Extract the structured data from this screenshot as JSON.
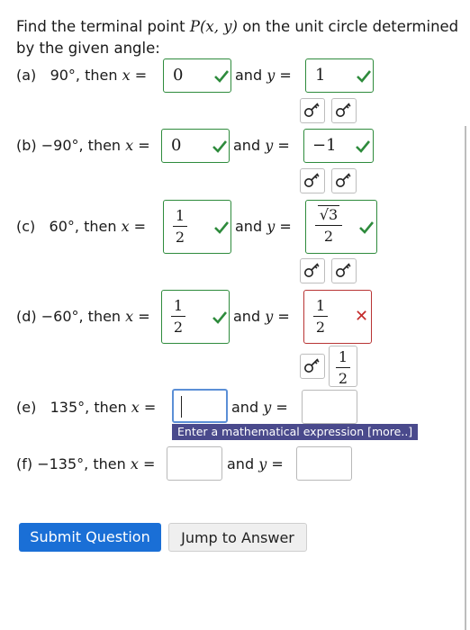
{
  "question": {
    "prompt_pre": "Find the terminal point ",
    "prompt_math": "P(x, y)",
    "prompt_post": " on the unit circle determined by the given angle:"
  },
  "parts": [
    {
      "label": "(a)",
      "angle": "90°",
      "x_value": "0",
      "y_value": "1",
      "x_status": "correct",
      "y_status": "correct"
    },
    {
      "label": "(b)",
      "angle": "−90°",
      "x_value": "0",
      "y_value": "−1",
      "x_status": "correct",
      "y_status": "correct"
    },
    {
      "label": "(c)",
      "angle": "60°",
      "x_num": "1",
      "x_den": "2",
      "y_num": "√3",
      "y_den": "2",
      "x_status": "correct",
      "y_status": "correct"
    },
    {
      "label": "(d)",
      "angle": "−60°",
      "x_num": "1",
      "x_den": "2",
      "y_num": "1",
      "y_den": "2",
      "x_status": "correct",
      "y_status": "incorrect",
      "y_answer_num": "1",
      "y_answer_den": "2"
    },
    {
      "label": "(e)",
      "angle": "135°",
      "x_value": "",
      "y_value": "",
      "x_status": "active",
      "y_status": "blank"
    },
    {
      "label": "(f)",
      "angle": "−135°",
      "x_value": "",
      "y_value": "",
      "x_status": "blank",
      "y_status": "blank"
    }
  ],
  "text": {
    "then_x": ", then ",
    "x_var": "x",
    "equals": " =",
    "and_y": "and ",
    "y_var": "y"
  },
  "tooltip": "Enter a mathematical expression [more..]",
  "buttons": {
    "submit": "Submit Question",
    "jump": "Jump to Answer"
  },
  "icons": {
    "key": "key-icon",
    "check": "check-icon",
    "wrong": "cross-icon"
  },
  "colors": {
    "correct": "#2e8b3c",
    "incorrect": "#b83434",
    "primary": "#1a6fd6",
    "tooltip": "#4a4a8c"
  }
}
